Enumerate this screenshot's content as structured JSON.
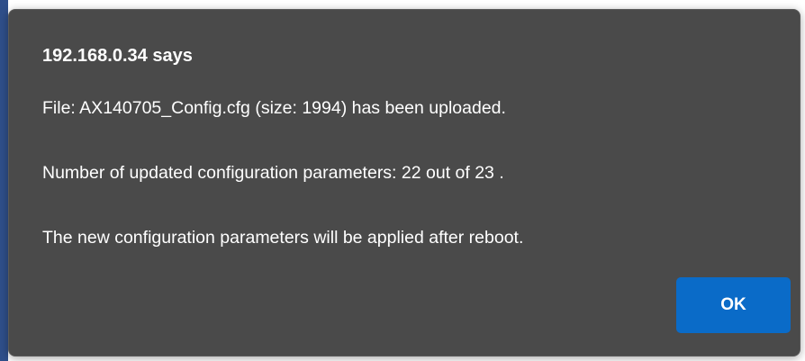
{
  "dialog": {
    "title": "192.168.0.34 says",
    "messages": [
      "File: AX140705_Config.cfg (size: 1994) has been uploaded.",
      "Number of updated configuration parameters: 22 out of 23 .",
      "The new configuration parameters will be applied after reboot."
    ],
    "ok_label": "OK"
  },
  "colors": {
    "dialog_background": "#4a4a4a",
    "button_accent": "#0a6bc8",
    "text": "#ffffff"
  }
}
